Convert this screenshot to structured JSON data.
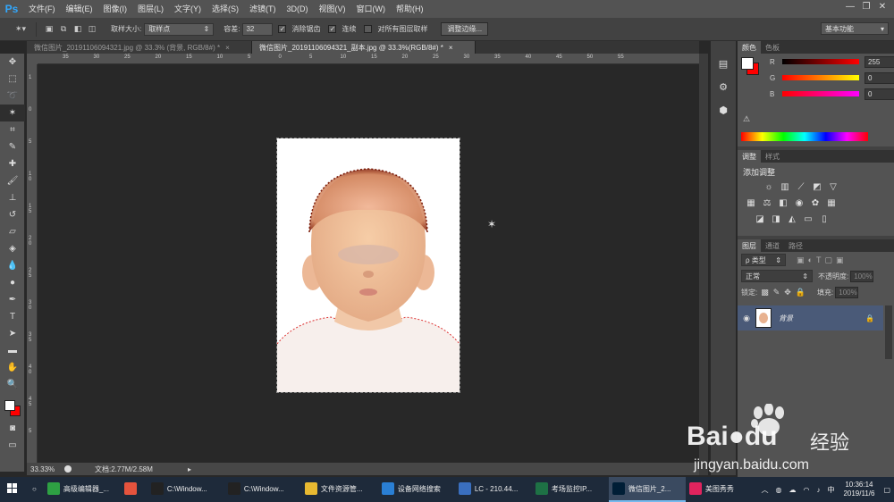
{
  "app": {
    "logo": "Ps",
    "menus": [
      "文件(F)",
      "编辑(E)",
      "图像(I)",
      "图层(L)",
      "文字(Y)",
      "选择(S)",
      "滤镜(T)",
      "3D(D)",
      "视图(V)",
      "窗口(W)",
      "帮助(H)"
    ],
    "window_controls": [
      "—",
      "❐",
      "✕"
    ]
  },
  "options_bar": {
    "sample_size_label": "取样大小:",
    "sample_size_value": "取样点",
    "tolerance_label": "容差:",
    "tolerance_value": "32",
    "anti_alias_label": "消除锯齿",
    "contiguous_label": "连续",
    "sample_all_label": "对所有图层取样",
    "refine_edge_label": "调整边缘...",
    "workspace": "基本功能"
  },
  "tabs": [
    {
      "label": "微信图片_20191106094321.jpg @ 33.3% (背景, RGB/8#) *",
      "close": "×"
    },
    {
      "label": "微信图片_20191106094321_副本.jpg @ 33.3%(RGB/8#) *",
      "close": "×"
    }
  ],
  "rulers": {
    "horizontal": [
      "35",
      "30",
      "25",
      "20",
      "15",
      "10",
      "5",
      "0",
      "5",
      "10",
      "15",
      "20",
      "25",
      "30",
      "35",
      "40",
      "45",
      "50",
      "55"
    ],
    "vertical": [
      "1",
      "0",
      "5",
      "1 0",
      "1 5",
      "2 0",
      "2 5",
      "3 0",
      "3 5",
      "4 0",
      "4 5",
      "5"
    ]
  },
  "status": {
    "zoom": "33.33%",
    "doc_info": "文档:2.77M/2.58M"
  },
  "color_panel": {
    "tabs": [
      "颜色",
      "色板"
    ],
    "channels": [
      {
        "name": "R",
        "value": "255"
      },
      {
        "name": "G",
        "value": "0"
      },
      {
        "name": "B",
        "value": "0"
      }
    ],
    "fg_color": "#ffffff",
    "bg_color": "#ff0000"
  },
  "adjustments_panel": {
    "tabs": [
      "调整",
      "样式"
    ],
    "heading": "添加调整"
  },
  "layers_panel": {
    "tabs": [
      "图层",
      "通道",
      "路径"
    ],
    "filter_label": "ρ 类型",
    "blend_mode": "正常",
    "opacity_label": "不透明度:",
    "opacity_value": "100%",
    "lock_label": "锁定:",
    "fill_label": "填充:",
    "fill_value": "100%",
    "layer_name": "背景"
  },
  "taskbar": {
    "items": [
      {
        "label": "高级编辑器_...",
        "icon": "editor-icon",
        "color": "#2ea043"
      },
      {
        "label": "",
        "icon": "chrome-icon",
        "color": "#e5533d"
      },
      {
        "label": "C:\\Window...",
        "icon": "cmd-icon",
        "color": "#222"
      },
      {
        "label": "C:\\Window...",
        "icon": "cmd-icon",
        "color": "#222"
      },
      {
        "label": "文件资源管...",
        "icon": "folder-icon",
        "color": "#e8b931"
      },
      {
        "label": "设备网络搜索",
        "icon": "network-icon",
        "color": "#2a7fd4"
      },
      {
        "label": "LC - 210.44...",
        "icon": "remote-icon",
        "color": "#3a6fbf"
      },
      {
        "label": "考场监控IP...",
        "icon": "excel-icon",
        "color": "#1e7145"
      },
      {
        "label": "微信图片_2...",
        "icon": "photoshop-icon",
        "color": "#001e36",
        "active": true
      },
      {
        "label": "美图秀秀",
        "icon": "meitu-icon",
        "color": "#e0245e"
      }
    ],
    "time": "10:36:14",
    "date": "2019/11/6"
  },
  "watermark": {
    "brand": "Bai",
    "brand2": "du",
    "cn": "经验",
    "url": "jingyan.baidu.com"
  }
}
